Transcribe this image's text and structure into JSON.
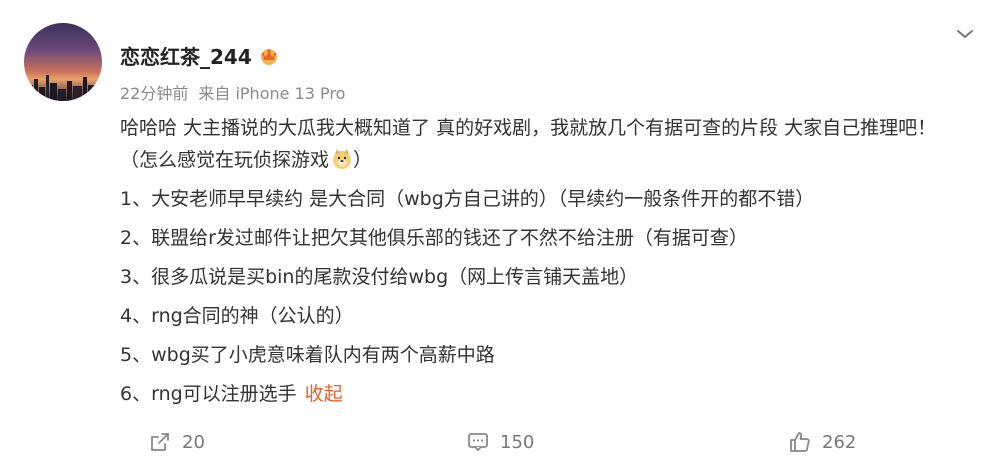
{
  "post": {
    "username": "恋恋红茶_244",
    "time": "22分钟前",
    "source": "来自 iPhone 13 Pro",
    "intro": "哈哈哈 大主播说的大瓜我大概知道了 真的好戏剧，我就放几个有据可查的片段 大家自己推理吧！（怎么感觉在玩侦探游戏",
    "intro_close": "）",
    "items": [
      "1、大安老师早早续约 是大合同（wbg方自己讲的）（早续约一般条件开的都不错）",
      "2、联盟给r发过邮件让把欠其他俱乐部的钱还了不然不给注册（有据可查）",
      "3、很多瓜说是买bin的尾款没付给wbg（网上传言铺天盖地）",
      "4、rng合同的神（公认的）",
      "5、wbg买了小虎意味着队内有两个高薪中路",
      "6、rng可以注册选手"
    ],
    "collapse_label": "收起"
  },
  "actions": {
    "repost_count": "20",
    "comment_count": "150",
    "like_count": "262"
  },
  "icons": {
    "badge": "crown-badge-icon",
    "emoji": "doge-emoji-icon",
    "menu": "chevron-down-icon",
    "repost": "repost-icon",
    "comment": "comment-icon",
    "like": "thumbs-up-icon"
  },
  "colors": {
    "accent": "#e8622c",
    "meta": "#8a8a8a",
    "text": "#333333"
  }
}
